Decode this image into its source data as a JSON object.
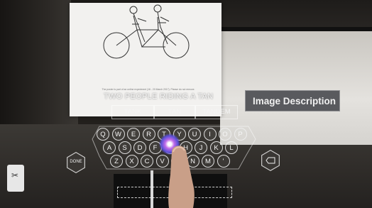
{
  "caption": "TWO PEOPLE RIDING A TAN",
  "suggestions": [
    "TANK",
    "TAN",
    "TANDEM"
  ],
  "panel": {
    "title": "Image Description"
  },
  "keyboard": {
    "row1": [
      "Q",
      "W",
      "E",
      "R",
      "T",
      "Y",
      "U",
      "I",
      "O",
      "P"
    ],
    "row2": [
      "A",
      "S",
      "D",
      "F",
      "G",
      "H",
      "J",
      "K",
      "L"
    ],
    "row3": [
      "Z",
      "X",
      "C",
      "V",
      "B",
      "N",
      "M",
      "'"
    ],
    "done_label": "DONE",
    "backspace_icon": "backspace-icon"
  },
  "paper_fine_print": "The poster is part of an online experiment (16 - 20 March 2017). Please do not remove."
}
